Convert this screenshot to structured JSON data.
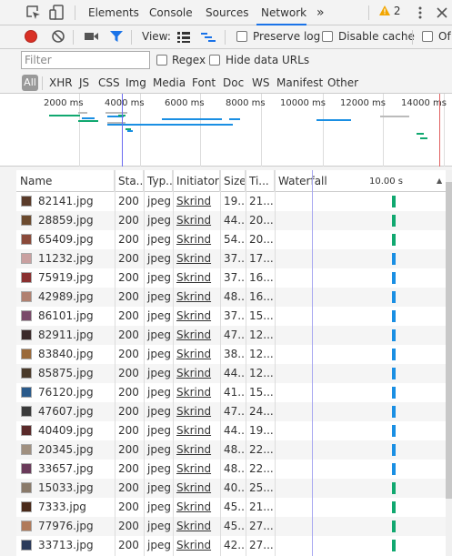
{
  "tabs": {
    "elements": "Elements",
    "console": "Console",
    "sources": "Sources",
    "network": "Network",
    "more": "»"
  },
  "warning_count": "2",
  "toolbar": {
    "view_label": "View:",
    "preserve_log": "Preserve log",
    "disable_cache": "Disable cache",
    "offline_cut": "Of"
  },
  "filter": {
    "placeholder": "Filter",
    "regex": "Regex",
    "hide_data_urls": "Hide data URLs"
  },
  "types": [
    "All",
    "XHR",
    "JS",
    "CSS",
    "Img",
    "Media",
    "Font",
    "Doc",
    "WS",
    "Manifest",
    "Other"
  ],
  "overview": {
    "ticks": [
      "2000 ms",
      "4000 ms",
      "6000 ms",
      "8000 ms",
      "10000 ms",
      "12000 ms",
      "14000 ms"
    ]
  },
  "table": {
    "headers": {
      "name": "Name",
      "status": "Sta..",
      "type": "Typ..",
      "initiator": "Initiator",
      "size": "Size",
      "time": "Ti...",
      "waterfall": "Waterfall",
      "waterfall_time": "10.00 s"
    },
    "rows": [
      {
        "name": "82141.jpg",
        "status": "200",
        "type": "jpeg",
        "initiator": "Skrind",
        "size": "19...",
        "time": "21...",
        "thumb": "#5a3b2a",
        "bar": "#11a870"
      },
      {
        "name": "28859.jpg",
        "status": "200",
        "type": "jpeg",
        "initiator": "Skrind",
        "size": "44...",
        "time": "20...",
        "thumb": "#6b4a2e",
        "bar": "#11a870"
      },
      {
        "name": "65409.jpg",
        "status": "200",
        "type": "jpeg",
        "initiator": "Skrind",
        "size": "54...",
        "time": "20...",
        "thumb": "#8a4a3a",
        "bar": "#11a870"
      },
      {
        "name": "11232.jpg",
        "status": "200",
        "type": "jpeg",
        "initiator": "Skrind",
        "size": "37...",
        "time": "17...",
        "thumb": "#c9a0a0",
        "bar": "#1a8fe3"
      },
      {
        "name": "75919.jpg",
        "status": "200",
        "type": "jpeg",
        "initiator": "Skrind",
        "size": "37...",
        "time": "16...",
        "thumb": "#8a3030",
        "bar": "#1a8fe3"
      },
      {
        "name": "42989.jpg",
        "status": "200",
        "type": "jpeg",
        "initiator": "Skrind",
        "size": "48...",
        "time": "16...",
        "thumb": "#b08070",
        "bar": "#1a8fe3"
      },
      {
        "name": "86101.jpg",
        "status": "200",
        "type": "jpeg",
        "initiator": "Skrind",
        "size": "37...",
        "time": "15...",
        "thumb": "#7a4a6a",
        "bar": "#1a8fe3"
      },
      {
        "name": "82911.jpg",
        "status": "200",
        "type": "jpeg",
        "initiator": "Skrind",
        "size": "47...",
        "time": "12...",
        "thumb": "#3a2a2a",
        "bar": "#1a8fe3"
      },
      {
        "name": "83840.jpg",
        "status": "200",
        "type": "jpeg",
        "initiator": "Skrind",
        "size": "38...",
        "time": "12...",
        "thumb": "#9a6a3a",
        "bar": "#1a8fe3"
      },
      {
        "name": "85875.jpg",
        "status": "200",
        "type": "jpeg",
        "initiator": "Skrind",
        "size": "44...",
        "time": "12...",
        "thumb": "#4a3a2a",
        "bar": "#1a8fe3"
      },
      {
        "name": "76120.jpg",
        "status": "200",
        "type": "jpeg",
        "initiator": "Skrind",
        "size": "41...",
        "time": "15...",
        "thumb": "#2a5a8a",
        "bar": "#1a8fe3"
      },
      {
        "name": "47607.jpg",
        "status": "200",
        "type": "jpeg",
        "initiator": "Skrind",
        "size": "47...",
        "time": "24...",
        "thumb": "#3a3a3a",
        "bar": "#1a8fe3"
      },
      {
        "name": "40409.jpg",
        "status": "200",
        "type": "jpeg",
        "initiator": "Skrind",
        "size": "44...",
        "time": "19...",
        "thumb": "#5a2a2a",
        "bar": "#1a8fe3"
      },
      {
        "name": "20345.jpg",
        "status": "200",
        "type": "jpeg",
        "initiator": "Skrind",
        "size": "48...",
        "time": "22...",
        "thumb": "#a09080",
        "bar": "#1a8fe3"
      },
      {
        "name": "33657.jpg",
        "status": "200",
        "type": "jpeg",
        "initiator": "Skrind",
        "size": "48...",
        "time": "22...",
        "thumb": "#6a3a5a",
        "bar": "#1a8fe3"
      },
      {
        "name": "15033.jpg",
        "status": "200",
        "type": "jpeg",
        "initiator": "Skrind",
        "size": "40...",
        "time": "25...",
        "thumb": "#8a7a6a",
        "bar": "#11a870"
      },
      {
        "name": "7333.jpg",
        "status": "200",
        "type": "jpeg",
        "initiator": "Skrind",
        "size": "45...",
        "time": "21...",
        "thumb": "#4a2a1a",
        "bar": "#11a870"
      },
      {
        "name": "77976.jpg",
        "status": "200",
        "type": "jpeg",
        "initiator": "Skrind",
        "size": "45...",
        "time": "27...",
        "thumb": "#b07a5a",
        "bar": "#11a870"
      },
      {
        "name": "33713.jpg",
        "status": "200",
        "type": "jpeg",
        "initiator": "Skrind",
        "size": "42...",
        "time": "27...",
        "thumb": "#2a3a5a",
        "bar": "#11a870"
      }
    ]
  }
}
